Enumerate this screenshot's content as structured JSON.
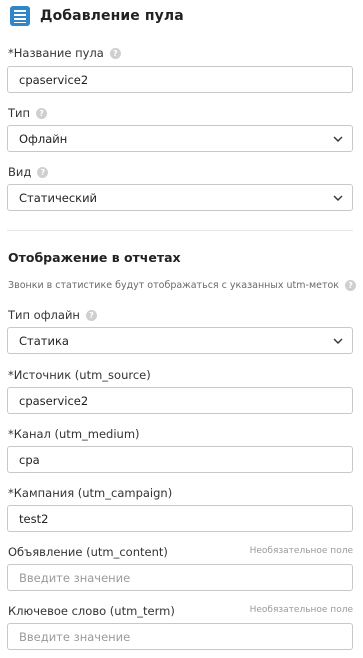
{
  "header": {
    "title": "Добавление пула",
    "icon": "list-table-icon",
    "icon_color": "#2f86c9"
  },
  "fields": {
    "pool_name": {
      "label": "*Название пула",
      "value": "cpaservice2"
    },
    "type": {
      "label": "Тип",
      "value": "Офлайн"
    },
    "kind": {
      "label": "Вид",
      "value": "Статический"
    }
  },
  "reports": {
    "title": "Отображение в отчетах",
    "hint": "Звонки в статистике будут отображаться с указанных utm-меток",
    "offline_type": {
      "label": "Тип офлайн",
      "value": "Статика"
    },
    "utm_source": {
      "label": "*Источник (utm_source)",
      "value": "cpaservice2"
    },
    "utm_medium": {
      "label": "*Канал (utm_medium)",
      "value": "cpa"
    },
    "utm_campaign": {
      "label": "*Кампания (utm_campaign)",
      "value": "test2"
    },
    "utm_content": {
      "label": "Объявление (utm_content)",
      "placeholder": "Введите значение",
      "optional": "Необязательное поле"
    },
    "utm_term": {
      "label": "Ключевое слово (utm_term)",
      "placeholder": "Введите значение",
      "optional": "Необязательное поле"
    }
  }
}
